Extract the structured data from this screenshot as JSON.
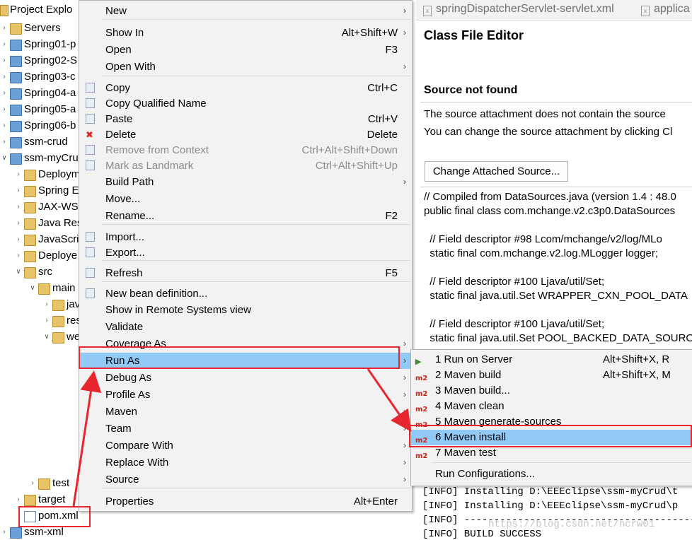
{
  "explorer": {
    "title": "Project Explo",
    "items": [
      {
        "label": "Servers",
        "depth": 0,
        "icon": "folder-icon"
      },
      {
        "label": "Spring01-p",
        "depth": 0,
        "icon": "project-icon"
      },
      {
        "label": "Spring02-S",
        "depth": 0,
        "icon": "project-icon"
      },
      {
        "label": "Spring03-c",
        "depth": 0,
        "icon": "project-icon"
      },
      {
        "label": "Spring04-a",
        "depth": 0,
        "icon": "project-icon"
      },
      {
        "label": "Spring05-a",
        "depth": 0,
        "icon": "project-icon"
      },
      {
        "label": "Spring06-b",
        "depth": 0,
        "icon": "project-icon"
      },
      {
        "label": "ssm-crud",
        "depth": 0,
        "icon": "maven-project-icon"
      },
      {
        "label": "ssm-myCru",
        "depth": 0,
        "icon": "maven-project-icon"
      },
      {
        "label": "Deploym",
        "depth": 1,
        "icon": "deploy-icon"
      },
      {
        "label": "Spring E",
        "depth": 1,
        "icon": "spring-icon"
      },
      {
        "label": "JAX-WS",
        "depth": 1,
        "icon": "jaxws-icon"
      },
      {
        "label": "Java Res",
        "depth": 1,
        "icon": "java-resources-icon"
      },
      {
        "label": "JavaScri",
        "depth": 1,
        "icon": "javascript-icon"
      },
      {
        "label": "Deploye",
        "depth": 1,
        "icon": "deployed-icon"
      },
      {
        "label": "src",
        "depth": 1,
        "icon": "folder-icon"
      },
      {
        "label": "main",
        "depth": 2,
        "icon": "folder-icon"
      },
      {
        "label": "jav",
        "depth": 3,
        "icon": "folder-icon"
      },
      {
        "label": "res",
        "depth": 3,
        "icon": "folder-icon"
      },
      {
        "label": "we",
        "depth": 3,
        "icon": "folder-icon"
      },
      {
        "label": "test",
        "depth": 2,
        "icon": "folder-icon"
      },
      {
        "label": "target",
        "depth": 1,
        "icon": "folder-icon"
      },
      {
        "label": "pom.xml",
        "depth": 1,
        "icon": "xml-file-icon"
      },
      {
        "label": "ssm-xml",
        "depth": 0,
        "icon": "project-icon"
      }
    ]
  },
  "tabs": [
    {
      "label": "springDispatcherServlet-servlet.xml"
    },
    {
      "label": "applica"
    }
  ],
  "editor": {
    "heading": "Class File Editor",
    "subheading": "Source not found",
    "line1": "The source attachment does not contain the source",
    "line2": "You can change the source attachment by clicking Cl",
    "button": "Change Attached Source...",
    "code": [
      "// Compiled from DataSources.java (version 1.4 : 48.0",
      "public final class com.mchange.v2.c3p0.DataSources",
      "",
      "  // Field descriptor #98 Lcom/mchange/v2/log/MLo",
      "  static final com.mchange.v2.log.MLogger logger;",
      "",
      "  // Field descriptor #100 Ljava/util/Set;",
      "  static final java.util.Set WRAPPER_CXN_POOL_DATA",
      "",
      "  // Field descriptor #100 Ljava/util/Set;",
      "  static final java.util.Set POOL_BACKED_DATA_SOURC"
    ]
  },
  "console": {
    "lines": [
      "[INFO] Installing D:\\EEEclipse\\ssm-myCrud\\t",
      "[INFO] Installing D:\\EEEclipse\\ssm-myCrud\\p",
      "[INFO] -----------------------------------------",
      "[INFO] BUILD SUCCESS"
    ],
    "watermark": "https://blog.csdn.net/ncrw01"
  },
  "context_menu": {
    "items": [
      {
        "label": "New",
        "accel": "",
        "submenu": true
      },
      {
        "separator": true
      },
      {
        "label": "Show In",
        "accel": "Alt+Shift+W",
        "submenu": true
      },
      {
        "label": "Open",
        "accel": "F3"
      },
      {
        "label": "Open With",
        "accel": "",
        "submenu": true
      },
      {
        "separator": true
      },
      {
        "label": "Copy",
        "accel": "Ctrl+C",
        "icon": "copy-icon"
      },
      {
        "label": "Copy Qualified Name",
        "accel": "",
        "icon": "copy-icon"
      },
      {
        "label": "Paste",
        "accel": "Ctrl+V",
        "icon": "paste-icon"
      },
      {
        "label": "Delete",
        "accel": "Delete",
        "icon": "delete-icon"
      },
      {
        "label": "Remove from Context",
        "accel": "Ctrl+Alt+Shift+Down",
        "disabled": true,
        "icon": "remove-context-icon"
      },
      {
        "label": "Mark as Landmark",
        "accel": "Ctrl+Alt+Shift+Up",
        "disabled": true,
        "icon": "landmark-icon"
      },
      {
        "label": "Build Path",
        "accel": "",
        "submenu": true
      },
      {
        "label": "Move...",
        "accel": ""
      },
      {
        "label": "Rename...",
        "accel": "F2"
      },
      {
        "separator": true
      },
      {
        "label": "Import...",
        "accel": "",
        "icon": "import-icon"
      },
      {
        "label": "Export...",
        "accel": "",
        "icon": "export-icon"
      },
      {
        "separator": true
      },
      {
        "label": "Refresh",
        "accel": "F5",
        "icon": "refresh-icon"
      },
      {
        "separator": true
      },
      {
        "label": "New bean definition...",
        "accel": "",
        "icon": "bean-icon"
      },
      {
        "label": "Show in Remote Systems view",
        "accel": ""
      },
      {
        "label": "Validate",
        "accel": ""
      },
      {
        "label": "Coverage As",
        "accel": "",
        "submenu": true
      },
      {
        "label": "Run As",
        "accel": "",
        "submenu": true,
        "highlighted": true
      },
      {
        "label": "Debug As",
        "accel": "",
        "submenu": true
      },
      {
        "label": "Profile As",
        "accel": "",
        "submenu": true
      },
      {
        "label": "Maven",
        "accel": "",
        "submenu": true
      },
      {
        "label": "Team",
        "accel": "",
        "submenu": true
      },
      {
        "label": "Compare With",
        "accel": "",
        "submenu": true
      },
      {
        "label": "Replace With",
        "accel": "",
        "submenu": true
      },
      {
        "label": "Source",
        "accel": "",
        "submenu": true
      },
      {
        "separator": true
      },
      {
        "label": "Properties",
        "accel": "Alt+Enter"
      }
    ]
  },
  "run_as_menu": {
    "items": [
      {
        "label": "1 Run on Server",
        "accel": "Alt+Shift+X, R",
        "icon": "run-on-server-icon"
      },
      {
        "label": "2 Maven build",
        "accel": "Alt+Shift+X, M",
        "icon": "maven-m2-icon",
        "icon_text": "m2"
      },
      {
        "label": "3 Maven build...",
        "accel": "",
        "icon": "maven-m2-icon",
        "icon_text": "m2"
      },
      {
        "label": "4 Maven clean",
        "accel": "",
        "icon": "maven-m2-icon",
        "icon_text": "m2"
      },
      {
        "label": "5 Maven generate-sources",
        "accel": "",
        "icon": "maven-m2-icon",
        "icon_text": "m2"
      },
      {
        "label": "6 Maven install",
        "accel": "",
        "icon": "maven-m2-icon",
        "icon_text": "m2",
        "highlighted": true
      },
      {
        "label": "7 Maven test",
        "accel": "",
        "icon": "maven-m2-icon",
        "icon_text": "m2"
      },
      {
        "separator": true
      },
      {
        "label": "Run Configurations...",
        "accel": ""
      }
    ]
  },
  "colors": {
    "highlight": "#91c9f7",
    "annotation": "#e8262f",
    "menu_bg": "#f2f2f2"
  }
}
